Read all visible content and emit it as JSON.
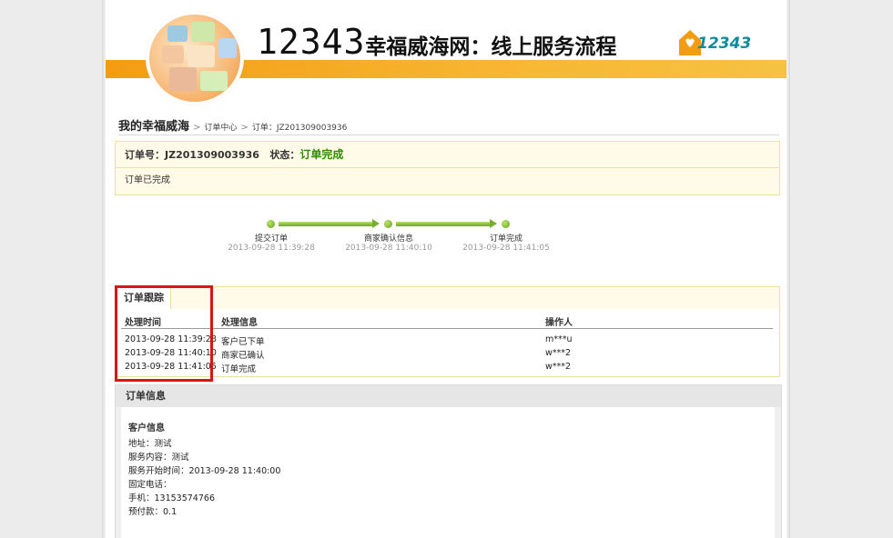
{
  "banner": {
    "title_number": "12343",
    "title_text": "幸福威海网：线上服务流程",
    "logo_text": "12343"
  },
  "breadcrumb": {
    "home": "我的幸福威海",
    "separator": ">",
    "items": [
      "订单中心",
      "订单：JZ201309003936"
    ]
  },
  "order_status": {
    "order_no_label": "订单号：",
    "order_no": "JZ201309003936",
    "status_label": "状态：",
    "status_value": "订单完成",
    "message": "订单已完成"
  },
  "progress": {
    "steps": [
      {
        "label": "提交订单",
        "time": "2013-09-28 11:39:28"
      },
      {
        "label": "商家确认信息",
        "time": "2013-09-28 11:40:10"
      },
      {
        "label": "订单完成",
        "time": "2013-09-28 11:41:05"
      }
    ]
  },
  "tracking": {
    "tab_label": "订单跟踪",
    "columns": [
      "处理时间",
      "处理信息",
      "操作人"
    ],
    "rows": [
      {
        "time": "2013-09-28 11:39:28",
        "info": "客户已下单",
        "operator": "m***u"
      },
      {
        "time": "2013-09-28 11:40:10",
        "info": "商家已确认",
        "operator": "w***2"
      },
      {
        "time": "2013-09-28 11:41:05",
        "info": "订单完成",
        "operator": "w***2"
      }
    ]
  },
  "order_info": {
    "title": "订单信息",
    "section_title": "客户信息",
    "lines": [
      "地址：测试",
      "服务内容：测试",
      "服务开始时间：2013-09-28 11:40:00",
      "固定电话：",
      "手机：13153574766",
      "预付款：0.1"
    ]
  },
  "colors": {
    "banner_orange": "#f39c12",
    "status_green": "#2e8b00",
    "highlight_red": "#d91515",
    "progress_green": "#6aa21c",
    "panel_bg": "#fffbe8"
  }
}
